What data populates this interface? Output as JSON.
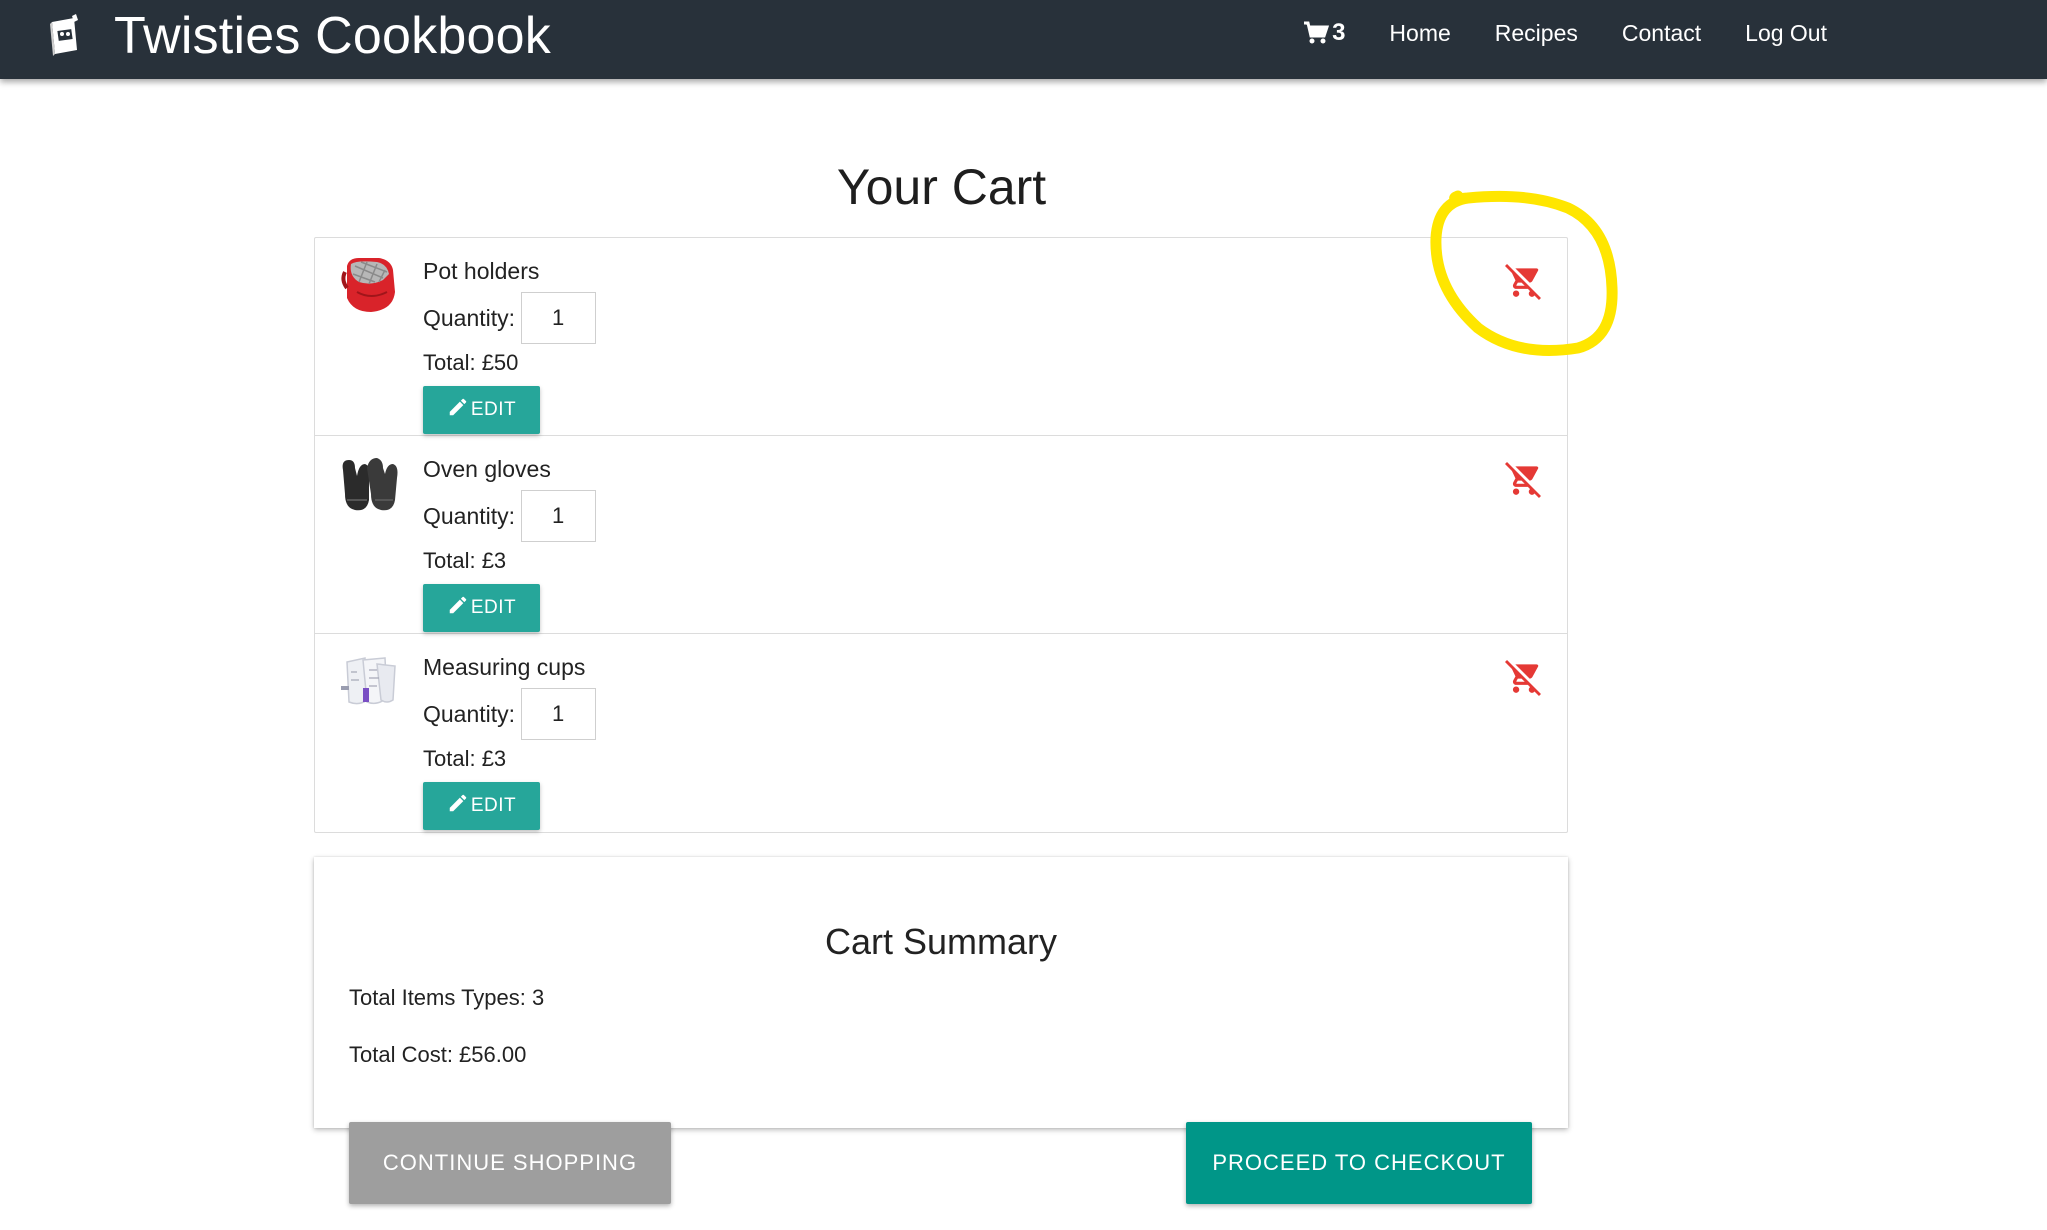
{
  "app": {
    "title": "Twisties Cookbook",
    "logo_icon": "cookbook-icon"
  },
  "nav": {
    "cart_icon": "cart-icon",
    "cart_count": "3",
    "links": [
      "Home",
      "Recipes",
      "Contact",
      "Log Out"
    ]
  },
  "page": {
    "title": "Your Cart"
  },
  "cart": {
    "quantity_label": "Quantity:",
    "edit_label": "EDIT",
    "edit_icon": "pencil-icon",
    "remove_icon": "remove-from-cart-icon",
    "items": [
      {
        "name": "Pot holders",
        "thumb": "pot-holder-image",
        "quantity": "1",
        "total": "Total: £50"
      },
      {
        "name": "Oven gloves",
        "thumb": "oven-gloves-image",
        "quantity": "1",
        "total": "Total: £3"
      },
      {
        "name": "Measuring cups",
        "thumb": "measuring-cups-image",
        "quantity": "1",
        "total": "Total: £3"
      }
    ]
  },
  "summary": {
    "title": "Cart Summary",
    "total_items": "Total Items Types: 3",
    "total_cost": "Total Cost: £56.00"
  },
  "actions": {
    "continue_label": "CONTINUE SHOPPING",
    "checkout_label": "PROCEED TO CHECKOUT"
  },
  "colors": {
    "navbar": "#28313a",
    "accent": "#26a69a",
    "checkout": "#009688",
    "continue": "#9e9e9e",
    "remove": "#e53935",
    "highlight": "#ffe600"
  }
}
